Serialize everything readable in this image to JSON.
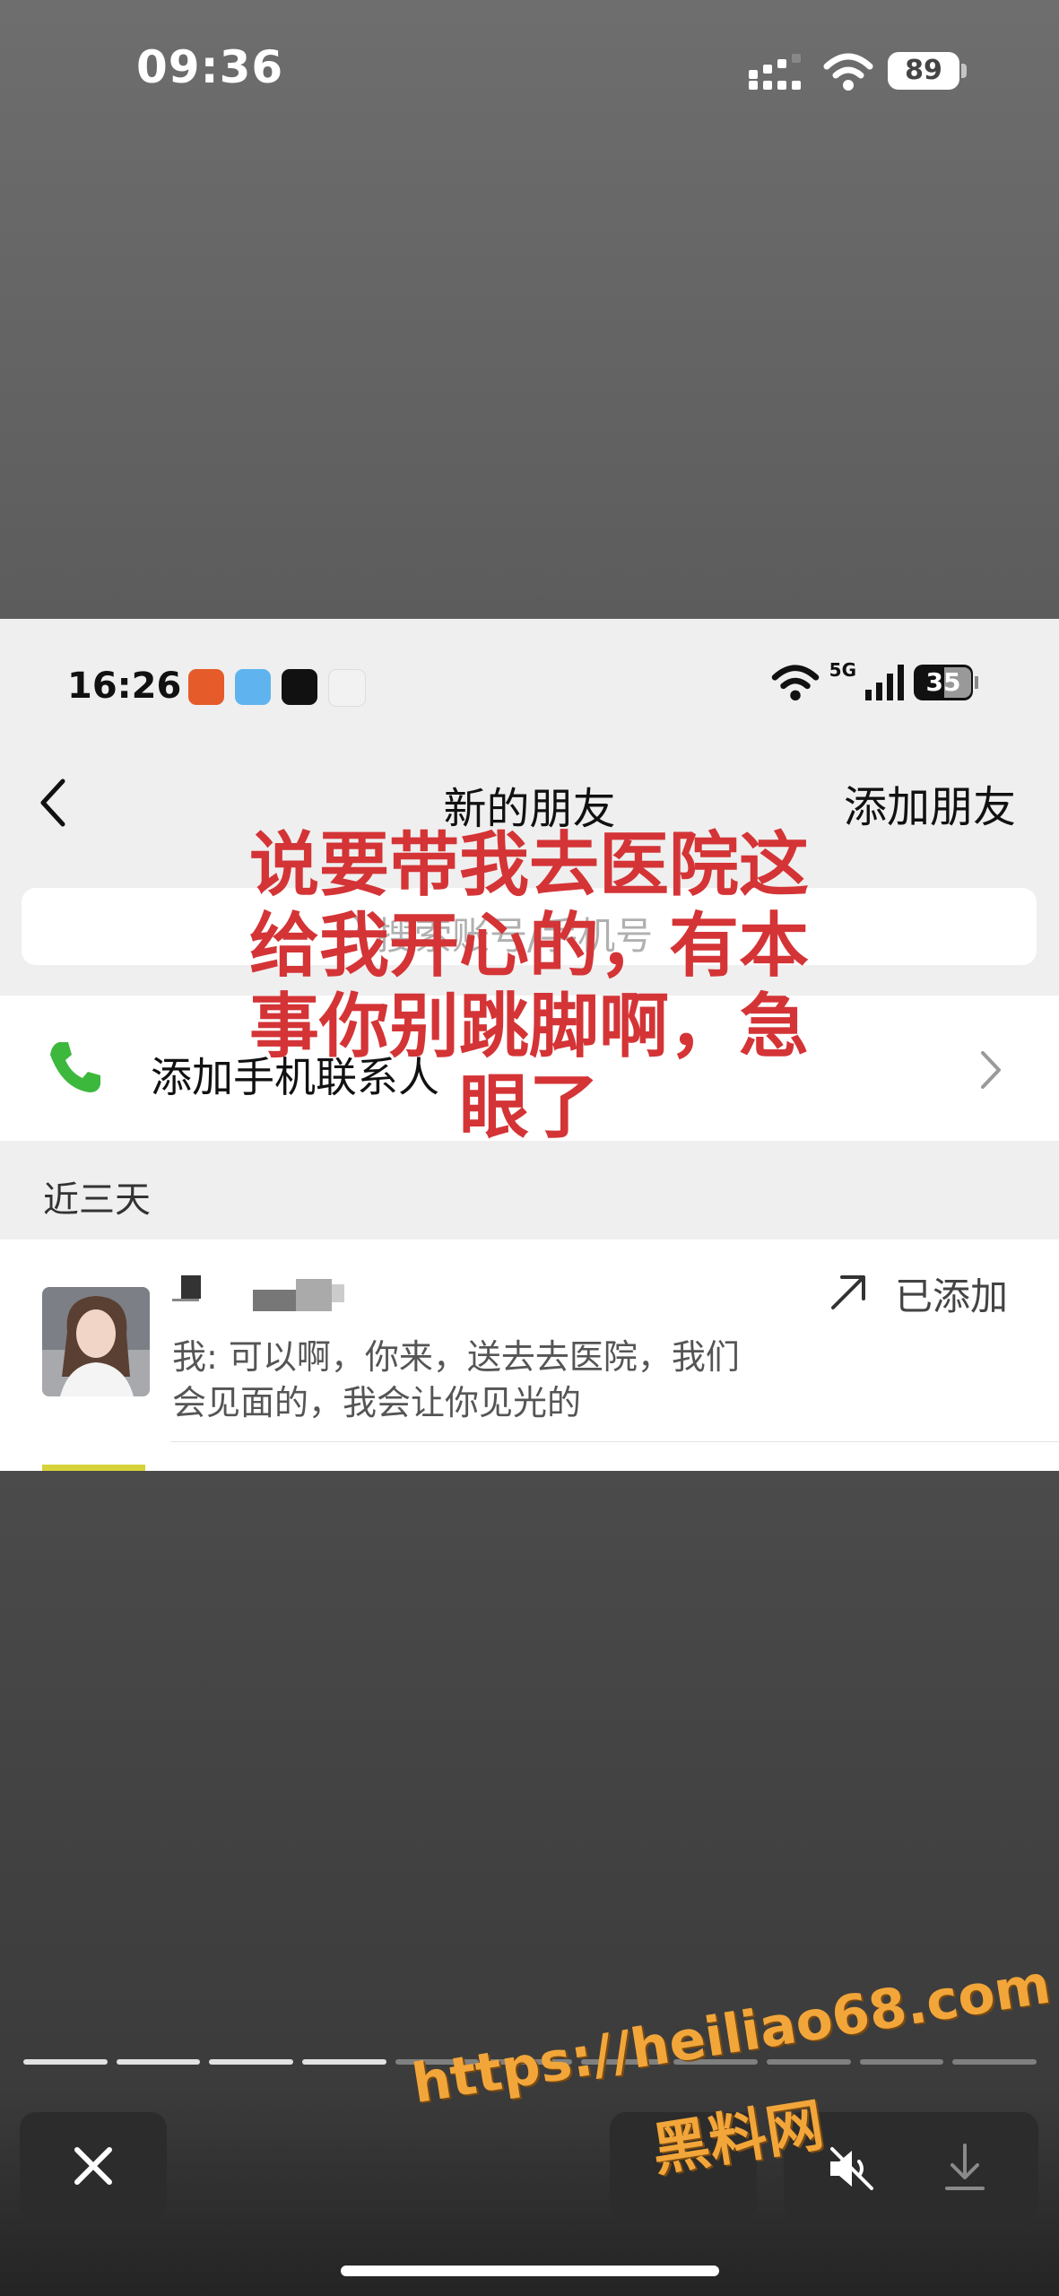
{
  "outer_status": {
    "time": "09:36",
    "battery": "89"
  },
  "inner_status": {
    "time": "16:26",
    "network": "5G",
    "battery": "35"
  },
  "nav": {
    "title": "新的朋友",
    "add_friend": "添加朋友"
  },
  "search": {
    "placeholder": "搜索账号/手机号"
  },
  "phone_row": {
    "label": "添加手机联系人"
  },
  "section": {
    "label": "近三天"
  },
  "friend": {
    "status": "已添加",
    "message_line1": "我: 可以啊，你来，送去去医院，我们",
    "message_line2": "会见面的，我会让你见光的"
  },
  "caption": {
    "line1": "说要带我去医院这",
    "line2": "给我开心的，有本",
    "line3": "事你别跳脚啊，急",
    "line4": "眼了"
  },
  "progress": {
    "total_segments": 11,
    "viewed_segments": 4
  },
  "watermark": {
    "url": "https://heiliao68.com",
    "name": "黑料网"
  },
  "icons": [
    "chevron-left-icon",
    "phone-icon",
    "search-icon",
    "chevron-right-icon",
    "arrow-up-right-icon",
    "close-icon",
    "mute-icon",
    "download-icon",
    "wifi-icon",
    "signal-icon",
    "battery-icon"
  ],
  "colors": {
    "caption": "#d43436",
    "phone_green": "#3cb83c",
    "watermark": "#f2a63a"
  }
}
